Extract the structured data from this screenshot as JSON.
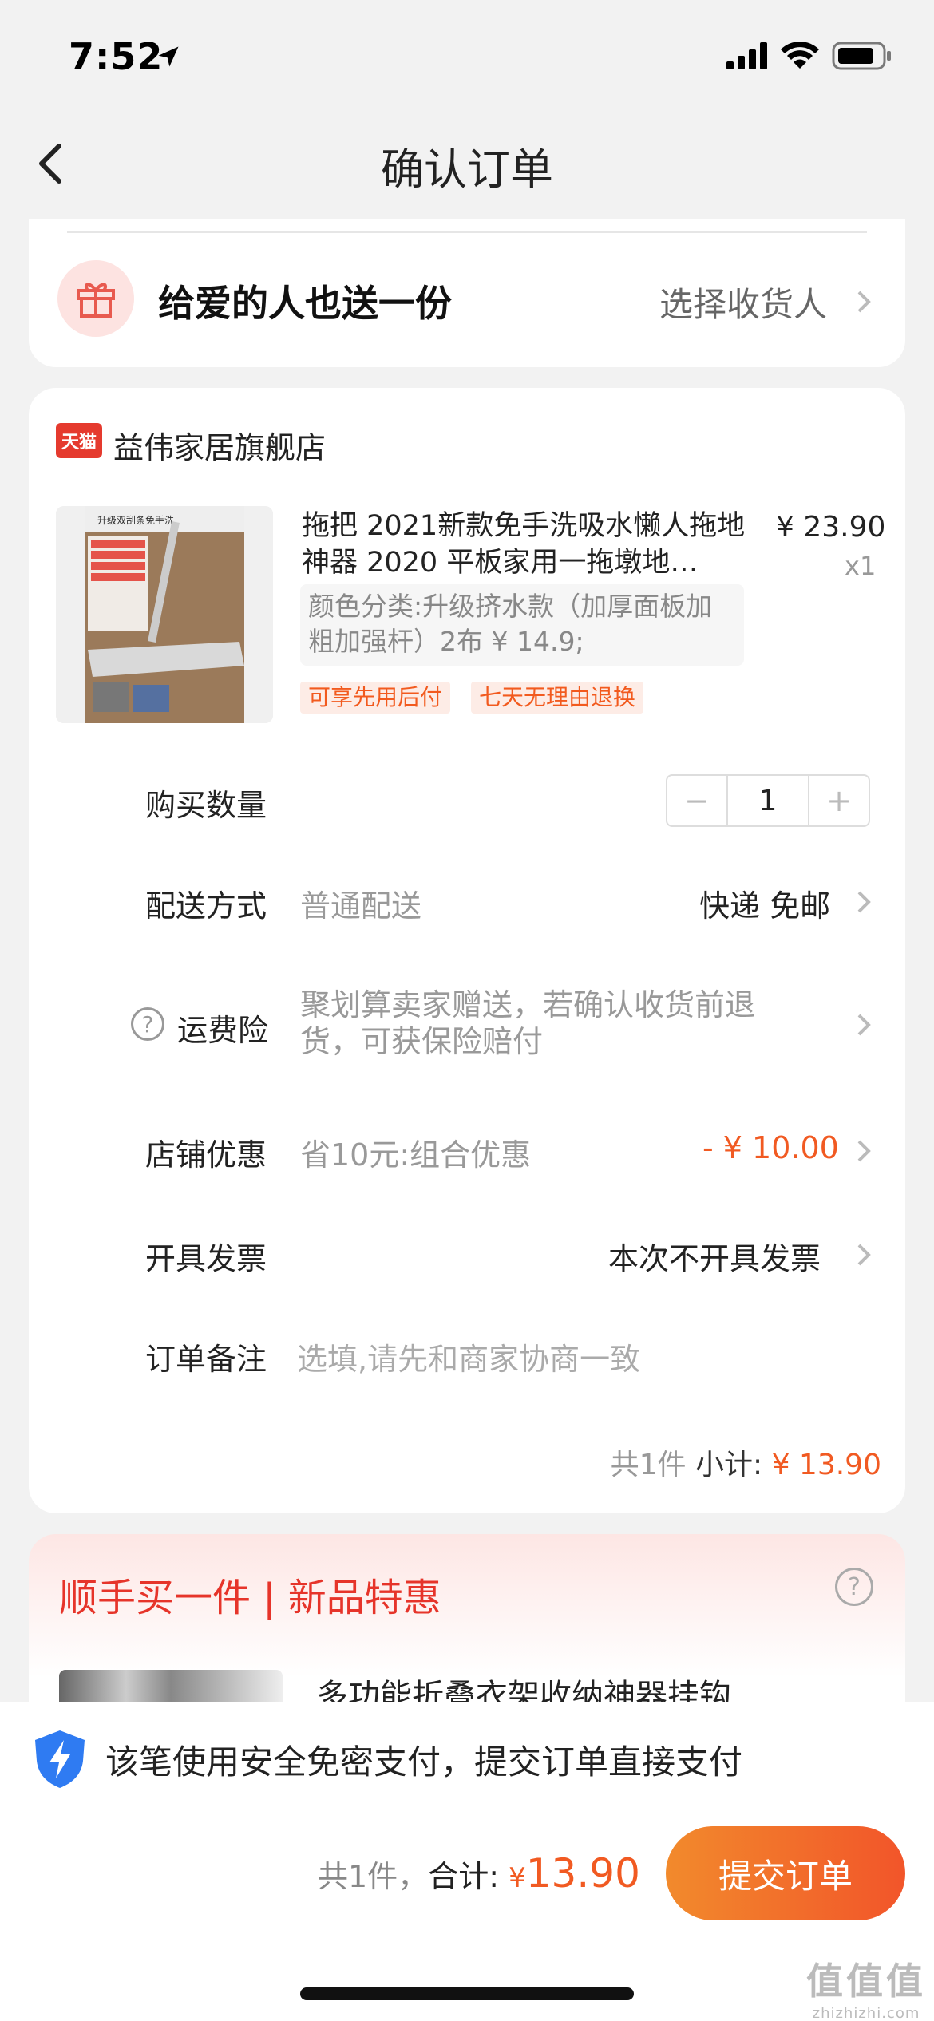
{
  "status": {
    "time": "7:52"
  },
  "nav": {
    "title": "确认订单"
  },
  "gift": {
    "title": "给爱的人也送一份",
    "choose": "选择收货人"
  },
  "store": {
    "badge": "天猫",
    "name": "益伟家居旗舰店"
  },
  "product": {
    "title": "拖把 2021新款免手洗吸水懒人拖地神器 2020 平板家用一拖墩地…",
    "price": "¥ 23.90",
    "quantity": "x1",
    "spec": "颜色分类:升级挤水款（加厚面板加粗加强杆）2布 ¥ 14.9;",
    "tags": [
      "可享先用后付",
      "七天无理由退换"
    ],
    "image_caption": "升级双刮条免手洗"
  },
  "rows": {
    "qty_label": "购买数量",
    "qty_value": "1",
    "qty_minus": "−",
    "qty_plus": "+",
    "delivery_label": "配送方式",
    "delivery_sub": "普通配送",
    "delivery_value": "快递 免邮",
    "insurance_label": "运费险",
    "insurance_help": "?",
    "insurance_sub": "聚划算卖家赠送，若确认收货前退货，可获保险赔付",
    "coupon_label": "店铺优惠",
    "coupon_sub": "省10元:组合优惠",
    "coupon_value": "- ¥ 10.00",
    "invoice_label": "开具发票",
    "invoice_value": "本次不开具发票",
    "note_label": "订单备注",
    "note_placeholder": "选填,请先和商家协商一致"
  },
  "subtotal": {
    "count": "共1件",
    "label": "小计:",
    "amount": "¥ 13.90"
  },
  "promo": {
    "title": "顺手买一件 | 新品特惠",
    "help": "?",
    "product": "多功能折叠衣架收纳神器挂钩"
  },
  "bottom": {
    "secure": "该笔使用安全免密支付，提交订单直接支付",
    "count": "共1件，",
    "total_label": "合计:",
    "currency": "¥",
    "total": "13.90",
    "submit": "提交订单"
  },
  "watermark": {
    "main": "值值值",
    "sub": "zhizhizhi.com"
  },
  "colors": {
    "accent": "#f15a22",
    "tmall": "#e53a2e",
    "promo_red": "#e6342a",
    "shield_blue": "#2f7bf2"
  }
}
